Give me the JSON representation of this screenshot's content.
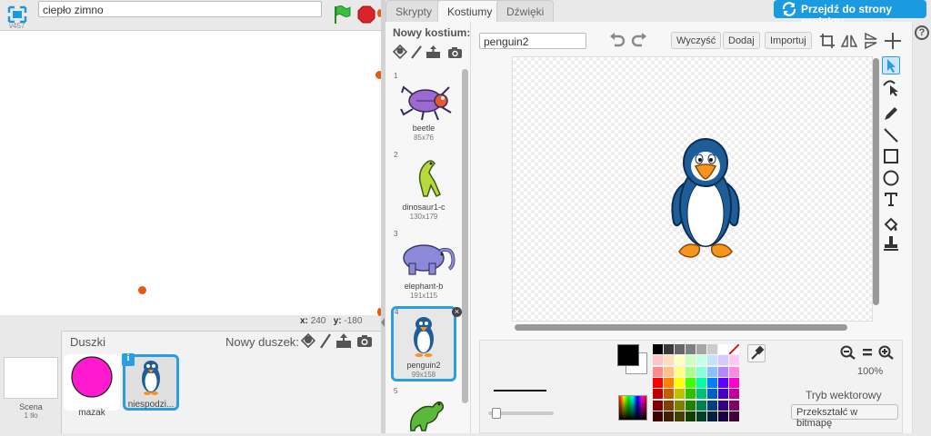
{
  "stage_header": {
    "project_title": "ciepło zimno",
    "version": "v457"
  },
  "stage": {
    "coords": {
      "x_label": "x:",
      "x_value": "240",
      "y_label": "y:",
      "y_value": "-180"
    }
  },
  "sprites": {
    "header": "Duszki",
    "new_sprite_label": "Nowy duszek:",
    "scene_label": "Scena",
    "scene_sub": "1 tło",
    "items": [
      {
        "name": "mazak"
      },
      {
        "name": "niespodzi..."
      }
    ]
  },
  "tabs": [
    {
      "label": "Skrypty"
    },
    {
      "label": "Kostiumy"
    },
    {
      "label": "Dźwięki"
    }
  ],
  "go_to_project_label": "Przejdź do strony projektu",
  "costumes": {
    "header": "Nowy kostium:",
    "items": [
      {
        "num": "1",
        "name": "beetle",
        "size": "85x76"
      },
      {
        "num": "2",
        "name": "dinosaur1-c",
        "size": "130x179"
      },
      {
        "num": "3",
        "name": "elephant-b",
        "size": "191x115"
      },
      {
        "num": "4",
        "name": "penguin2",
        "size": "99x158"
      },
      {
        "num": "5",
        "name": "",
        "size": ""
      }
    ]
  },
  "editor": {
    "costume_name": "penguin2",
    "clear_label": "Wyczyść",
    "add_label": "Dodaj",
    "import_label": "Importuj",
    "zoom_percent": "100%",
    "mode_label": "Tryb wektorowy",
    "convert_label": "Przekształć w bitmapę"
  },
  "colors": {
    "accent": "#2a9ee0",
    "pen_pink": "#ff1ad0",
    "stage_dot": "#e55b11"
  }
}
